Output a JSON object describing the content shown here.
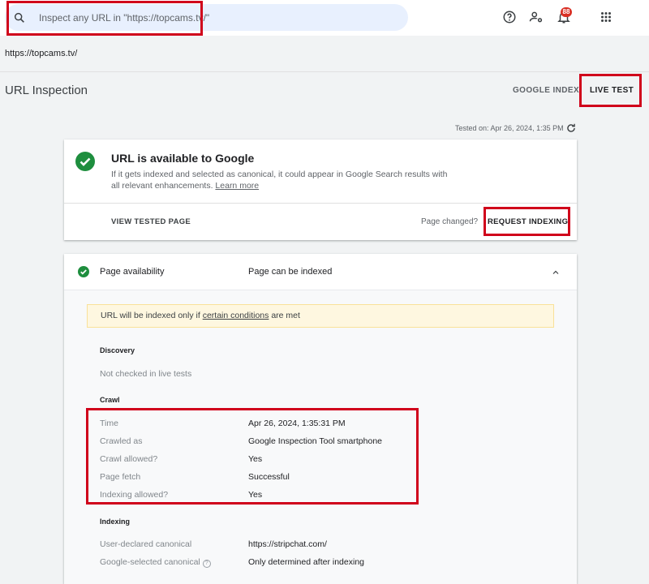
{
  "topbar": {
    "search_placeholder": "Inspect any URL in \"https://topcams.tv/\"",
    "notification_count": "88",
    "icons": [
      "search-icon",
      "help-icon",
      "manage-users-icon",
      "notifications-icon",
      "apps-grid-icon"
    ]
  },
  "property_url": "https://topcams.tv/",
  "page": {
    "title": "URL Inspection",
    "tabs": [
      "GOOGLE INDEX",
      "LIVE TEST"
    ],
    "tested_on": "Tested on: Apr 26, 2024, 1:35 PM"
  },
  "result_card": {
    "status": "URL is available to Google",
    "description": "If it gets indexed and selected as canonical, it could appear in Google Search results with all relevant enhancements.",
    "learn_more": "Learn more",
    "view_tested_page": "VIEW TESTED PAGE",
    "page_changed": "Page changed?",
    "request_indexing": "REQUEST INDEXING"
  },
  "availability": {
    "label": "Page availability",
    "value": "Page can be indexed",
    "notice_prefix": "URL will be indexed only if",
    "notice_link": "certain conditions",
    "notice_suffix": "are met",
    "discovery": {
      "heading": "Discovery",
      "value": "Not checked in live tests"
    },
    "crawl": {
      "heading": "Crawl",
      "rows": [
        {
          "label": "Time",
          "value": "Apr 26, 2024, 1:35:31 PM"
        },
        {
          "label": "Crawled as",
          "value": "Google Inspection Tool smartphone"
        },
        {
          "label": "Crawl allowed?",
          "value": "Yes"
        },
        {
          "label": "Page fetch",
          "value": "Successful"
        },
        {
          "label": "Indexing allowed?",
          "value": "Yes"
        }
      ]
    },
    "indexing": {
      "heading": "Indexing",
      "rows": [
        {
          "label": "User-declared canonical",
          "value": "https://stripchat.com/"
        },
        {
          "label": "Google-selected canonical",
          "value": "Only determined after indexing"
        }
      ]
    }
  },
  "colors": {
    "success_green": "#1e8e3e",
    "highlight_red": "#d0021b",
    "search_bg": "#e8f0fe",
    "notice_bg": "#fef7e0"
  }
}
